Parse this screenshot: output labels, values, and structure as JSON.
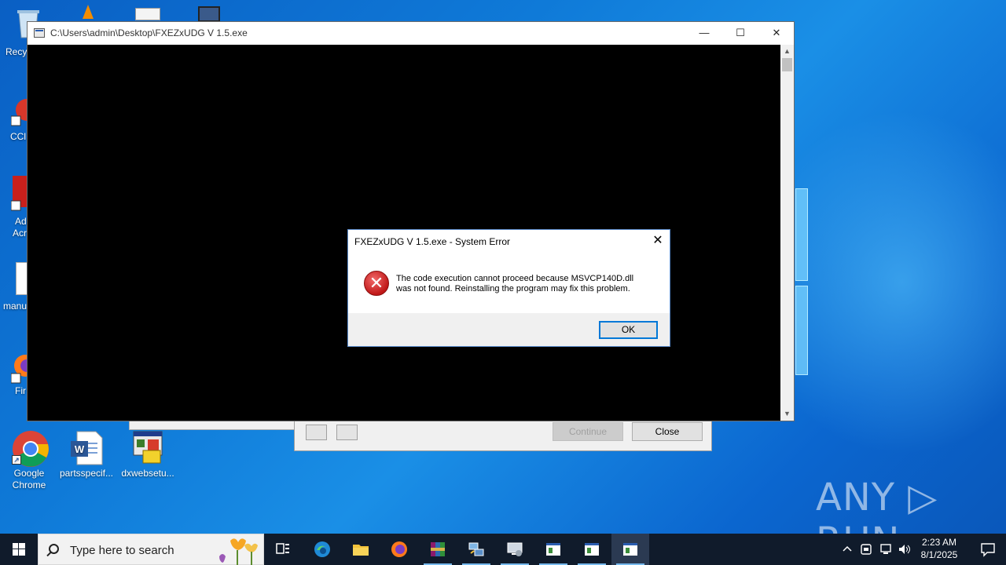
{
  "desktop": {
    "icons": [
      {
        "label": "Google Chrome"
      },
      {
        "label": "partsspecif..."
      },
      {
        "label": "dxwebsetu..."
      }
    ],
    "partial_labels": [
      "Recy",
      "CCl",
      "Ad",
      "Acr",
      "manu",
      "Fir"
    ]
  },
  "background_dialog": {
    "continue_label": "Continue",
    "close_label": "Close"
  },
  "console_window": {
    "title": "C:\\Users\\admin\\Desktop\\FXEZxUDG V 1.5.exe",
    "minimize_glyph": "—",
    "maximize_glyph": "☐",
    "close_glyph": "✕"
  },
  "error_dialog": {
    "title": "FXEZxUDG V 1.5.exe - System Error",
    "message_line1": "The code execution cannot proceed because MSVCP140D.dll",
    "message_line2": "was not found. Reinstalling the program may fix this problem.",
    "ok_label": "OK",
    "icon": "error-icon",
    "close_glyph": "✕"
  },
  "watermark": {
    "text": "ANY ▷ RUN"
  },
  "taskbar": {
    "search_placeholder": "Type here to search",
    "pinned": [
      "task-view-icon",
      "edge-icon",
      "file-explorer-icon",
      "firefox-icon",
      "winrar-icon",
      "network-tool-icon",
      "remote-desktop-icon",
      "app-window-icon",
      "app-window-icon",
      "console-app-icon"
    ],
    "clock_time": "2:23 AM",
    "clock_date": "8/1/2025",
    "accent": "#76b9ed"
  }
}
